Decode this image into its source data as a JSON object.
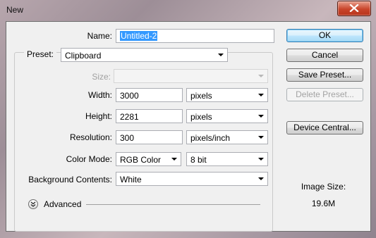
{
  "window": {
    "title": "New"
  },
  "form": {
    "name": {
      "label": "Name:",
      "value": "Untitled-2"
    },
    "preset": {
      "label": "Preset:",
      "value": "Clipboard"
    },
    "size": {
      "label": "Size:",
      "value": ""
    },
    "width": {
      "label": "Width:",
      "value": "3000",
      "unit": "pixels"
    },
    "height": {
      "label": "Height:",
      "value": "2281",
      "unit": "pixels"
    },
    "resolution": {
      "label": "Resolution:",
      "value": "300",
      "unit": "pixels/inch"
    },
    "color_mode": {
      "label": "Color Mode:",
      "value": "RGB Color",
      "depth": "8 bit"
    },
    "background": {
      "label": "Background Contents:",
      "value": "White"
    },
    "advanced": {
      "label": "Advanced"
    }
  },
  "buttons": {
    "ok": "OK",
    "cancel": "Cancel",
    "save_preset": "Save Preset...",
    "delete_preset": "Delete Preset...",
    "device_central": "Device Central..."
  },
  "image_size": {
    "label": "Image Size:",
    "value": "19.6M"
  },
  "colors": {
    "selection": "#3399ff",
    "close_button": "#c9452b"
  },
  "icons": {
    "close": "close-icon",
    "advanced": "chevron-double-down-icon"
  }
}
